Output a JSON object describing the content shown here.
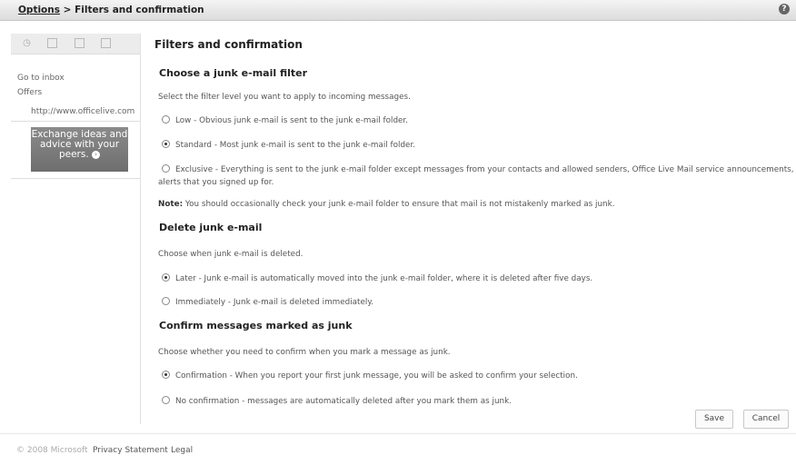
{
  "breadcrumb": {
    "options": "Options",
    "separator": " > ",
    "current": "Filters and confirmation"
  },
  "help_icon": "?",
  "sidebar": {
    "icons": [
      "clock-icon",
      "calendar-icon",
      "book-icon",
      "list-icon"
    ],
    "go_to_inbox": "Go to inbox",
    "offers": "Offers",
    "offer_url": "http://www.officelive.com",
    "ad_text": "Exchange ideas and advice with your peers."
  },
  "main": {
    "title": "Filters and confirmation",
    "junk_filter": {
      "heading": "Choose a junk e-mail filter",
      "description": "Select the filter level you want to apply to incoming messages.",
      "low": "Low - Obvious junk e-mail is sent to the junk e-mail folder.",
      "standard": "Standard - Most junk e-mail is sent to the junk e-mail folder.",
      "exclusive_line1": "Exclusive - Everything is sent to the junk e-mail folder except messages from your contacts and allowed senders, Office Live Mail service announcements, and",
      "exclusive_line2": "alerts that you signed up for.",
      "selected": "standard"
    },
    "note": {
      "label": "Note:",
      "text": " You should occasionally check your junk e-mail folder to ensure that mail is not mistakenly marked as junk."
    },
    "delete_junk": {
      "heading": "Delete junk e-mail",
      "description": "Choose when junk e-mail is deleted.",
      "later": "Later - Junk e-mail is automatically moved into the junk e-mail folder, where it is deleted after five days.",
      "immediately": "Immediately - Junk e-mail is deleted immediately.",
      "selected": "later"
    },
    "confirm_junk": {
      "heading": "Confirm messages marked as junk",
      "description": "Choose whether you need to confirm when you mark a message as junk.",
      "confirmation": "Confirmation - When you report your first junk message, you will be asked to confirm your selection.",
      "no_confirmation": "No confirmation - messages are automatically deleted after you mark them as junk.",
      "selected": "confirmation"
    },
    "save_label": "Save",
    "cancel_label": "Cancel"
  },
  "footer": {
    "copyright": "© 2008 Microsoft",
    "privacy": "Privacy Statement",
    "legal": "Legal"
  },
  "colors": {
    "ad_background": "#7a7a7a",
    "topbar": "#e6e6e6"
  }
}
